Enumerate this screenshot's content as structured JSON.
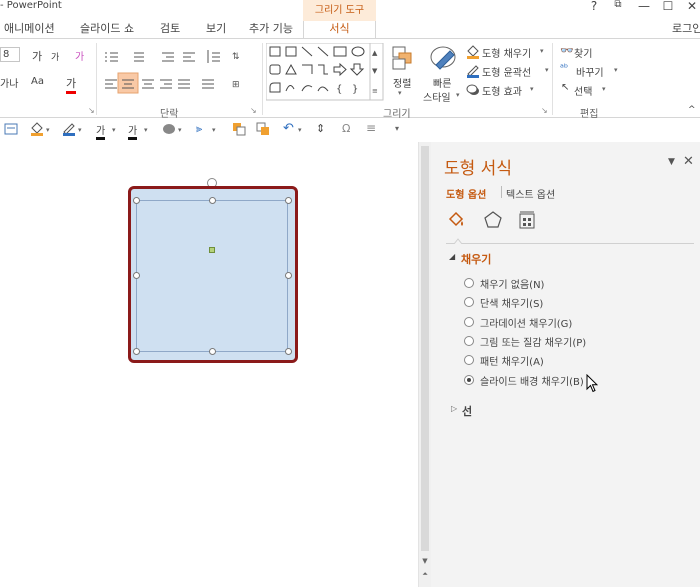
{
  "window": {
    "title": "- PowerPoint",
    "help": "?",
    "ribbon_display": "⧉",
    "minimize": "—",
    "restore": "☐",
    "close": "✕",
    "signin": "로그인"
  },
  "tabs": [
    {
      "label": "애니메이션"
    },
    {
      "label": "슬라이드 쇼"
    },
    {
      "label": "검토"
    },
    {
      "label": "보기"
    },
    {
      "label": "추가 기능"
    }
  ],
  "context_tab": {
    "group": "그리기 도구",
    "tab": "서식"
  },
  "ribbon": {
    "font": {
      "size": "8",
      "grow": "가",
      "shrink": "가",
      "clear": "가",
      "char_spacing": "가나",
      "change_case": "Aa",
      "font_color": "가"
    },
    "paragraph": {
      "label": "단락"
    },
    "drawing": {
      "label": "그리기",
      "arrange": "정렬",
      "quick_styles_1": "빠른",
      "quick_styles_2": "스타일",
      "shape_fill": "도형 채우기",
      "shape_outline": "도형 윤곽선",
      "shape_effects": "도형 효과"
    },
    "editing": {
      "label": "편집",
      "find": "찾기",
      "replace": "바꾸기",
      "select": "선택"
    }
  },
  "qbar": {
    "font_color": "가",
    "highlight": "가",
    "omega": "Ω"
  },
  "pane": {
    "title": "도형 서식",
    "tab_shape": "도형 옵션",
    "tab_text": "텍스트 옵션",
    "fill_section": "채우기",
    "line_section": "선",
    "fill_options": [
      {
        "label": "채우기 없음(N)",
        "selected": false
      },
      {
        "label": "단색 채우기(S)",
        "selected": false
      },
      {
        "label": "그라데이션 채우기(G)",
        "selected": false
      },
      {
        "label": "그림 또는 질감 채우기(P)",
        "selected": false
      },
      {
        "label": "패턴 채우기(A)",
        "selected": false
      },
      {
        "label": "슬라이드 배경 채우기(B)",
        "selected": true
      }
    ]
  },
  "colors": {
    "accent": "#c55a11",
    "shape_fill": "#cfe0f1",
    "shape_outline": "#8b1a1a"
  }
}
